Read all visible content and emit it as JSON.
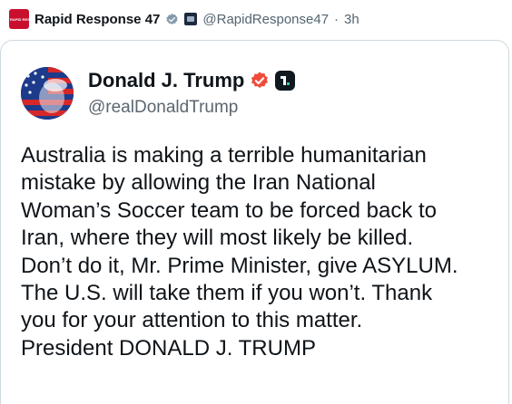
{
  "retweeter": {
    "avatar_text": "RAPID RESPONSE",
    "name": "Rapid Response 47",
    "handle": "@RapidResponse47",
    "separator": "·",
    "time": "3h"
  },
  "embedded_post": {
    "author_name": "Donald J. Trump",
    "author_handle": "@realDonaldTrump",
    "text": "Australia is making a terrible humanitarian\nmistake by allowing the Iran National\nWoman’s Soccer team to be forced back to\nIran, where they will most likely be killed.\nDon’t do it, Mr. Prime Minister, give ASYLUM.\nThe U.S. will take them if you won’t. Thank\nyou for your attention to this matter.\nPresident DONALD J. TRUMP"
  },
  "colors": {
    "verified_grey": "#829aab",
    "verified_red": "#f04b3a",
    "text_primary": "#0f1419",
    "text_secondary": "#536471"
  },
  "icons": {
    "retweeter_verified": "verified-badge-icon",
    "affiliation": "affiliation-badge-icon",
    "author_verified": "verified-badge-icon",
    "platform": "truth-social-icon"
  }
}
